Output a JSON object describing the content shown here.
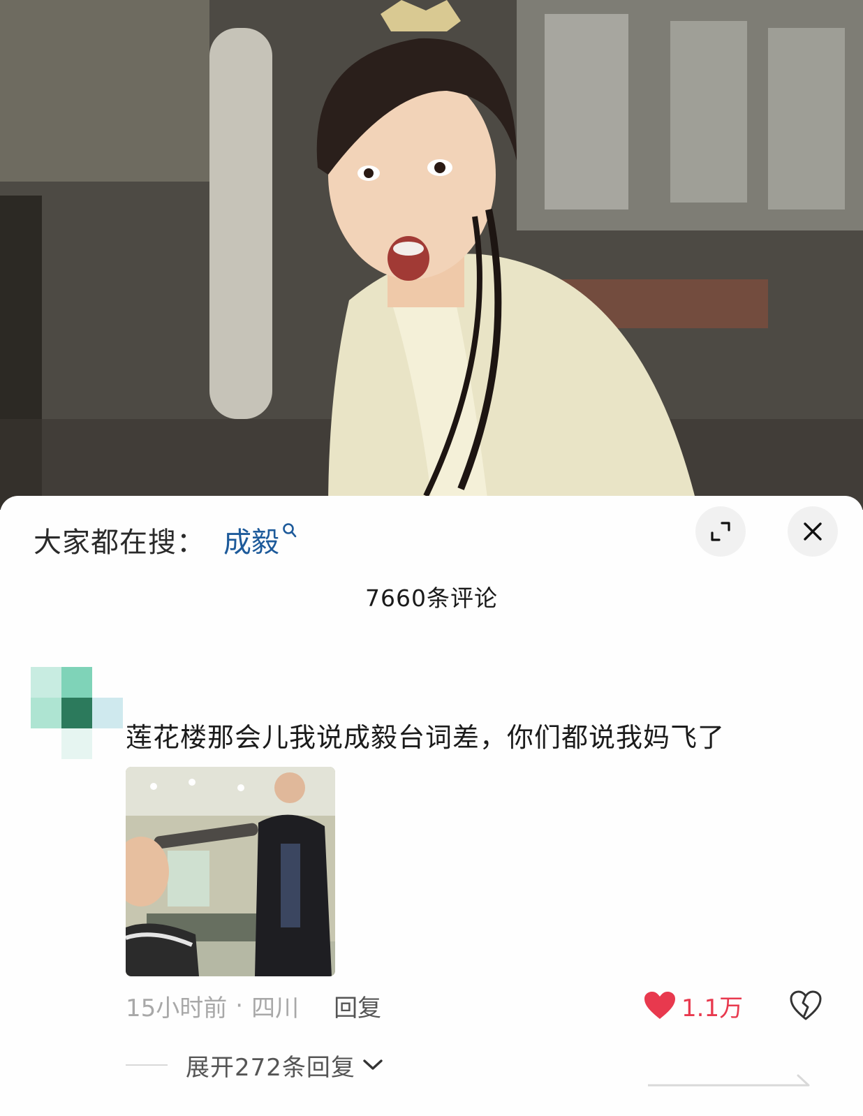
{
  "sheet": {
    "search_prefix": "大家都在搜：",
    "search_keyword": "成毅",
    "expand_icon": "expand-icon",
    "close_icon": "close-icon",
    "comment_count": "7660条评论"
  },
  "comment": {
    "text": "莲花楼那会儿我说成毅台词差，你们都说我妈飞了",
    "time": "15小时前",
    "separator": "·",
    "location": "四川",
    "reply_label": "回复",
    "like_count": "1.1万",
    "expand_replies": "展开272条回复"
  },
  "colors": {
    "keyword": "#1d5a9a",
    "like": "#e8394e",
    "muted": "#a8a8a8"
  }
}
